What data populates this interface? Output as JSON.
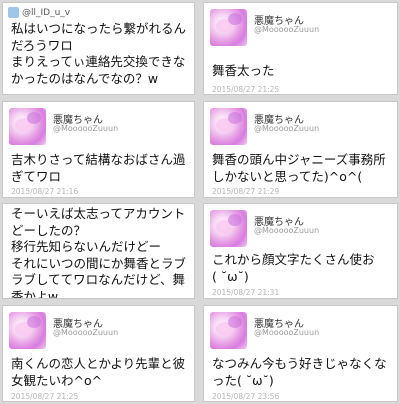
{
  "tweets": [
    {
      "handle": "@ll_ID_u_v",
      "text": "私はいつになったら繋がれるん\nだろうワロ\nまりえってぃ連絡先交換できな\nかったのはなんでなの？w",
      "time": ""
    },
    {
      "name": "悪魔ちゃん",
      "handle": "@MoooooZuuun",
      "text": "舞香太った",
      "time": "2015/08/27 21:25"
    },
    {
      "name": "悪魔ちゃん",
      "handle": "@MoooooZuuun",
      "text": "吉木りさって結構なおばさん過\nぎてワロ",
      "time": "2015/08/27 21:16"
    },
    {
      "name": "悪魔ちゃん",
      "handle": "@MoooooZuuun",
      "text": "舞香の頭ん中ジャニーズ事務所\nしかないと思ってた)^o^(",
      "time": "2015/08/27 21:29"
    },
    {
      "name": "",
      "handle": "",
      "text": "そーいえば太志ってアカウント\nどーしたの？\n移行先知らないんだけどー\nそれにいつの間にか舞香とラブ\nラブしててワロなんだけど、舞\n香かよw",
      "time": ""
    },
    {
      "name": "悪魔ちゃん",
      "handle": "@MoooooZuuun",
      "text": "これから顔文字たくさん使お\n( ˘ω˘)",
      "time": "2015/08/27 21:31"
    },
    {
      "name": "悪魔ちゃん",
      "handle": "@MoooooZuuun",
      "text": "南くんの恋人とかより先輩と彼\n女観たいわ^o^",
      "time": "2015/08/27 21:25"
    },
    {
      "name": "悪魔ちゃん",
      "handle": "@MoooooZuuun",
      "text": "なつみん今もう好きじゃなくな\nった( ˘ω˘)",
      "time": "2015/08/27 23:56"
    }
  ]
}
